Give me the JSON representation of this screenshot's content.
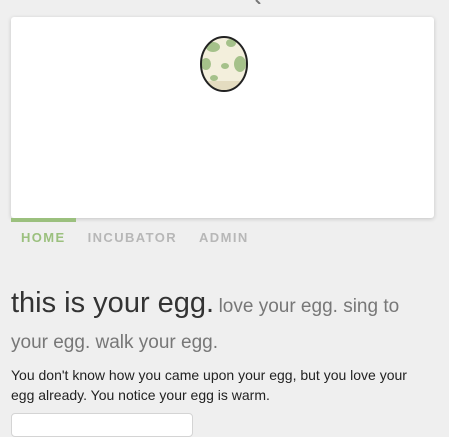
{
  "nav": {
    "tabs": [
      {
        "label": "HOME",
        "active": true
      },
      {
        "label": "INCUBATOR",
        "active": false
      },
      {
        "label": "ADMIN",
        "active": false
      }
    ]
  },
  "main": {
    "heading": "this is your egg.",
    "subheading": "love your egg. sing to your egg. walk your egg.",
    "description": "You don't know how you came upon your egg, but you love your egg already. You notice your egg is warm."
  },
  "colors": {
    "accent": "#9bc07e",
    "egg_shell": "#f3efdc",
    "egg_spots": "#a5c18a"
  },
  "icons": {
    "egg": "egg-sprite",
    "top": "search-icon"
  }
}
